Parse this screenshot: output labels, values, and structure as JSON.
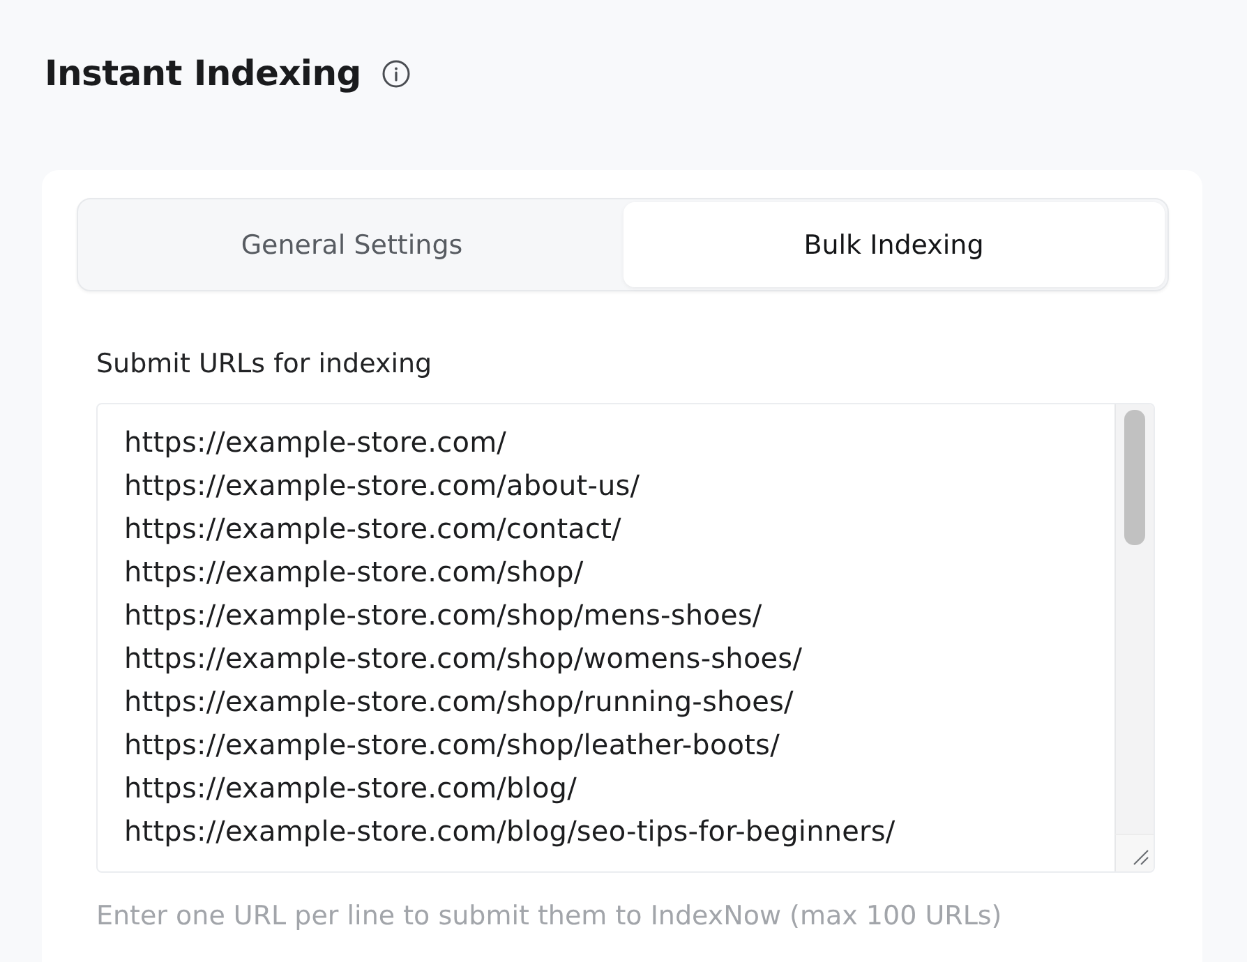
{
  "page": {
    "title": "Instant Indexing"
  },
  "tabs": [
    {
      "label": "General Settings",
      "selected": false
    },
    {
      "label": "Bulk Indexing",
      "selected": true
    }
  ],
  "bulk_indexing": {
    "label": "Submit URLs for indexing",
    "urls": [
      "https://example-store.com/",
      "https://example-store.com/about-us/",
      "https://example-store.com/contact/",
      "https://example-store.com/shop/",
      "https://example-store.com/shop/mens-shoes/",
      "https://example-store.com/shop/womens-shoes/",
      "https://example-store.com/shop/running-shoes/",
      "https://example-store.com/shop/leather-boots/",
      "https://example-store.com/blog/",
      "https://example-store.com/blog/seo-tips-for-beginners/"
    ],
    "help_text": "Enter one URL per line to submit them to IndexNow (max 100 URLs)"
  }
}
